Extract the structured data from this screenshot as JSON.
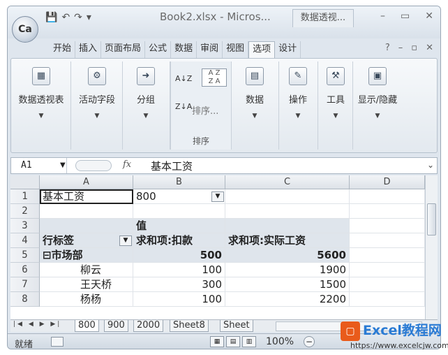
{
  "title_bar": {
    "office_button": "Ca",
    "document_title": "Book2.xlsx - Micros...",
    "context_tab": "数据透视..."
  },
  "ribbon_tabs": [
    "开始",
    "插入",
    "页面布局",
    "公式",
    "数据",
    "审阅",
    "视图",
    "选项",
    "设计"
  ],
  "active_tab": "选项",
  "ribbon_groups": {
    "pivot_table": "数据透视表",
    "active_field": "活动字段",
    "group": "分组",
    "sort_button": "排序...",
    "sort_group_label": "排序",
    "data": "数据",
    "actions": "操作",
    "tools": "工具",
    "show_hide": "显示/隐藏"
  },
  "formula_bar": {
    "name_box": "A1",
    "fx": "fx",
    "value": "基本工资"
  },
  "columns": [
    "A",
    "B",
    "C",
    "D"
  ],
  "rows": [
    {
      "num": "1",
      "a": "基本工资",
      "b": "800",
      "c": ""
    },
    {
      "num": "2",
      "a": "",
      "b": "",
      "c": ""
    },
    {
      "num": "3",
      "a": "",
      "b": "值",
      "c": ""
    },
    {
      "num": "4",
      "a": "行标签",
      "b": "求和项:扣款",
      "c": "求和项:实际工资"
    },
    {
      "num": "5",
      "a": "⊟市场部",
      "b": "500",
      "c": "5600"
    },
    {
      "num": "6",
      "a": "柳云",
      "b": "100",
      "c": "1900"
    },
    {
      "num": "7",
      "a": "王天桥",
      "b": "300",
      "c": "1500"
    },
    {
      "num": "8",
      "a": "杨杨",
      "b": "100",
      "c": "2200"
    }
  ],
  "sheet_tabs": [
    "800",
    "900",
    "2000",
    "Sheet8",
    "Sheet"
  ],
  "active_sheet": "800",
  "status": {
    "ready": "就绪",
    "zoom": "100%"
  },
  "watermark": {
    "title": "Excel教程网",
    "url": "https://www.excelcjw.com"
  }
}
